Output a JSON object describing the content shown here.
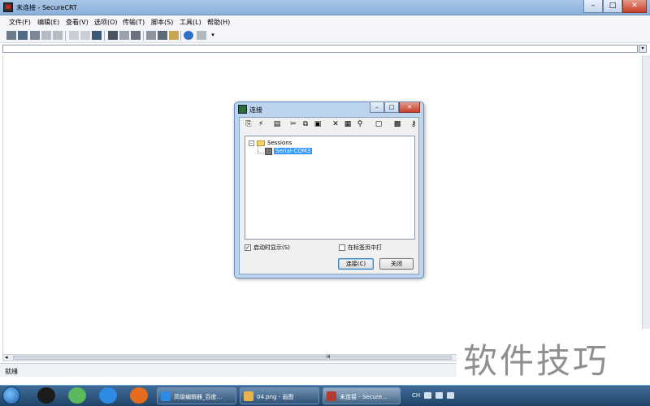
{
  "window": {
    "title": "未连接 - SecureCRT",
    "controls": {
      "minimize": "–",
      "maximize": "□",
      "close": "✕"
    }
  },
  "menu": [
    "文件(F)",
    "编辑(E)",
    "查看(V)",
    "选项(O)",
    "传输(T)",
    "脚本(S)",
    "工具(L)",
    "帮助(H)"
  ],
  "toolbar": {
    "icons": [
      "connect-icon",
      "quick-connect-icon",
      "connect-tab-icon",
      "reconnect-icon",
      "disconnect-icon",
      "copy-icon",
      "paste-icon",
      "find-icon",
      "print-icon",
      "print-setup-icon",
      "printer-icon",
      "session-options-icon",
      "global-options-icon",
      "keymap-icon",
      "help-icon",
      "about-icon"
    ],
    "overflow": "▾"
  },
  "address_bar": {
    "value": "",
    "button": "▾"
  },
  "status": {
    "text": "就绪"
  },
  "hscroll": {
    "left": "◂",
    "right": "▸",
    "grip": "III"
  },
  "dialog": {
    "title": "连接",
    "controls": {
      "minimize": "–",
      "maximize": "□",
      "close": "✕"
    },
    "toolbar_icons": [
      "new-session-icon",
      "quick-connect-icon",
      "new-folder-icon",
      "cut-icon",
      "copy-icon",
      "paste-icon",
      "delete-icon",
      "properties-icon",
      "find-icon",
      "folder-open-icon",
      "monitor-icon",
      "key-icon"
    ],
    "toolbar_glyphs": [
      "⎘",
      "⚡",
      "▤",
      "✂",
      "⧉",
      "▣",
      "✕",
      "▦",
      "⚲",
      "▢",
      "▩",
      "⚷"
    ],
    "tree": {
      "root": {
        "label": "Sessions",
        "expander": "–"
      },
      "children": [
        {
          "label": "Serial-COM3",
          "selected": true
        }
      ]
    },
    "show_on_startup": {
      "label": "启动时显示(S)",
      "checked": true,
      "mark": "✓"
    },
    "open_in_tab": {
      "label": "在标签页中打",
      "checked": false,
      "mark": ""
    },
    "buttons": {
      "connect": "连接(C)",
      "close": "关闭"
    }
  },
  "taskbar": {
    "items": [
      {
        "label": "高级编辑器_百度...",
        "icon_color": "#2d8be3"
      },
      {
        "label": "04.png - 画图",
        "icon_color": "#e8b24a"
      },
      {
        "label": "未连接 - Secure...",
        "icon_color": "#b33b2f",
        "active": true
      }
    ],
    "lang": "CH"
  },
  "watermark": {
    "text": "软件技巧"
  }
}
